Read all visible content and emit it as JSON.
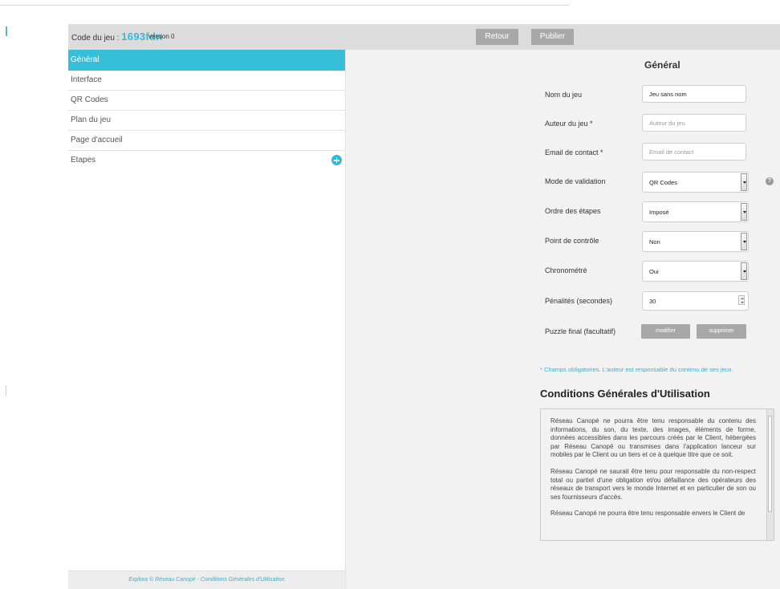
{
  "header": {
    "code_label": "Code du jeu : ",
    "code_value": "1693fdn",
    "version": "version 0",
    "back_label": "Retour",
    "publish_label": "Publier"
  },
  "sidebar": {
    "items": [
      {
        "label": "Général"
      },
      {
        "label": "Interface"
      },
      {
        "label": "QR Codes"
      },
      {
        "label": "Plan du jeu"
      },
      {
        "label": "Page d'accueil"
      },
      {
        "label": "Etapes"
      }
    ],
    "footer": "Explora © Réseau Canopé - Conditions Générales d'Utilisation"
  },
  "main": {
    "title": "Général",
    "fields": {
      "name": {
        "label": "Nom du jeu",
        "value": "Jeu sans nom"
      },
      "author": {
        "label": "Auteur du jeu *",
        "placeholder": "Auteur du jeu"
      },
      "email": {
        "label": "Email de contact *",
        "placeholder": "Email de contact"
      },
      "validation": {
        "label": "Mode de validation",
        "value": "QR Codes"
      },
      "order": {
        "label": "Ordre des étapes",
        "value": "Imposé"
      },
      "checkpoint": {
        "label": "Point de contrôle",
        "value": "Non"
      },
      "timed": {
        "label": "Chronométré",
        "value": "Oui"
      },
      "penalties": {
        "label": "Pénalités (secondes)",
        "value": "30"
      },
      "puzzle": {
        "label": "Puzzle final (facultatif)",
        "modify": "modifier",
        "delete": "supprimer"
      }
    },
    "required_note": "* Champs obligatoires. L'auteur est responsable du contenu de ses jeux.",
    "cgu_title": "Conditions Générales d'Utilisation",
    "cgu_paragraphs": [
      "Réseau Canopé ne pourra être tenu responsable du contenu des informations, du son, du texte, des images, éléments de forme, données accessibles dans les parcours créés par le Client, hébergées par Réseau Canopé ou transmises dans l'application lanceur sur mobiles par le Client ou un tiers et ce à quelque titre que ce soit.",
      "Réseau Canopé ne saurait être tenu pour responsable du non-respect total ou partiel d'une obligation et/ou défaillance des opérateurs des réseaux de transport vers le monde Internet et en particulier de son ou ses fournisseurs d'accès.",
      "Réseau Canopé ne pourra être tenu responsable envers le Client de"
    ]
  },
  "icons": {
    "help": "help-icon",
    "add": "plus-circle-icon"
  },
  "colors": {
    "accent": "#36bfd8",
    "button": "#a8a8a8"
  }
}
